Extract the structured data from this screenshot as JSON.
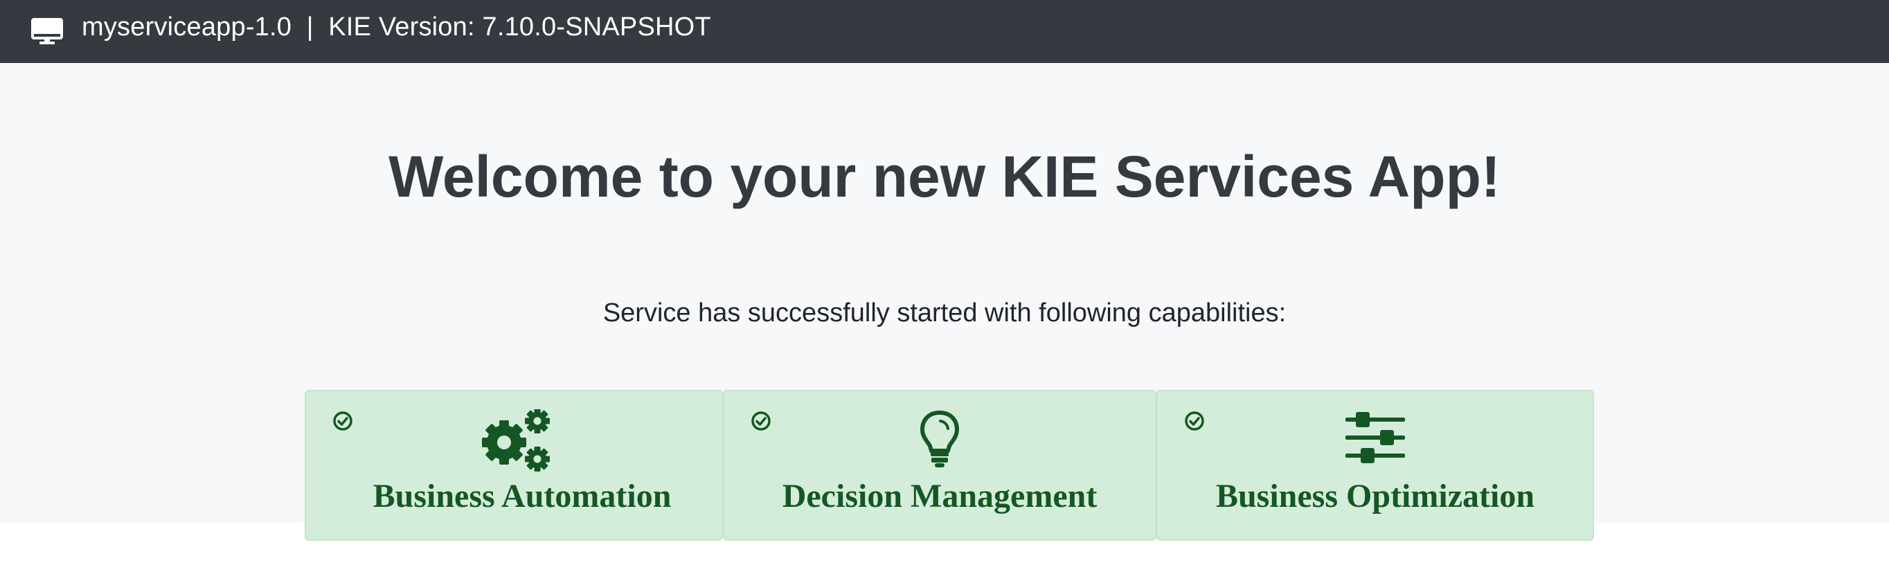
{
  "navbar": {
    "icon": "desktop-icon",
    "app_name": "myserviceapp-1.0",
    "separator": "|",
    "version_text": "KIE Version: 7.10.0-SNAPSHOT"
  },
  "main": {
    "heading": "Welcome to your new KIE Services App!",
    "subtitle": "Service has successfully started with following capabilities:",
    "capabilities": [
      {
        "label": "Business Automation",
        "icon": "cogs-icon",
        "status_icon": "check-circle-icon"
      },
      {
        "label": "Decision Management",
        "icon": "lightbulb-icon",
        "status_icon": "check-circle-icon"
      },
      {
        "label": "Business Optimization",
        "icon": "sliders-icon",
        "status_icon": "check-circle-icon"
      }
    ]
  },
  "colors": {
    "navbar_bg": "#343a40",
    "page_bg": "#f7f8fa",
    "card_bg": "#d4edda",
    "card_border": "#c3e6cb",
    "card_text": "#155724",
    "heading": "#343a40"
  }
}
